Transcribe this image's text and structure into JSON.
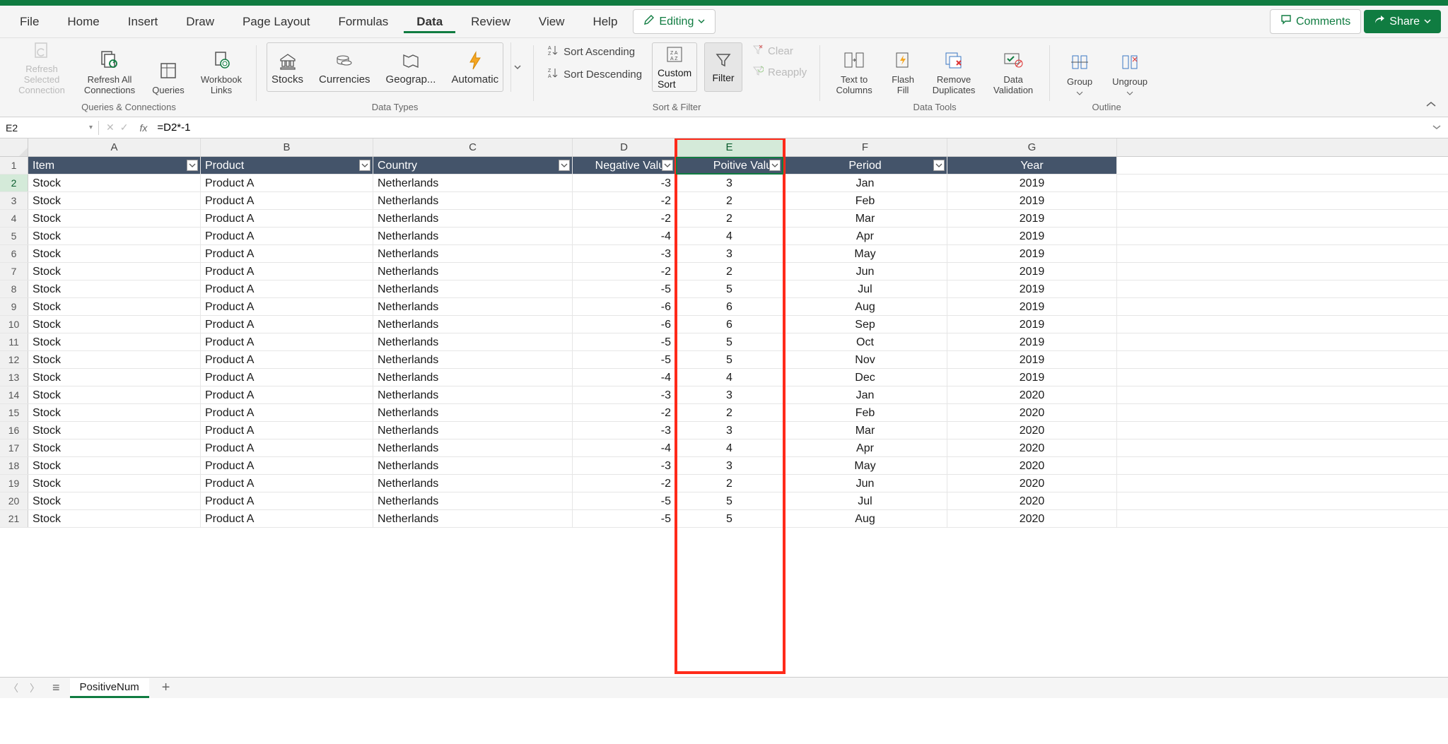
{
  "menu": {
    "file": "File",
    "home": "Home",
    "insert": "Insert",
    "draw": "Draw",
    "page_layout": "Page Layout",
    "formulas": "Formulas",
    "data": "Data",
    "review": "Review",
    "view": "View",
    "help": "Help"
  },
  "editing_label": "Editing",
  "comments_label": "Comments",
  "share_label": "Share",
  "ribbon": {
    "queries_conn": {
      "refresh_sel": "Refresh Selected Connection",
      "refresh_all": "Refresh All Connections",
      "queries": "Queries",
      "workbook_links": "Workbook Links",
      "group": "Queries & Connections"
    },
    "data_types": {
      "stocks": "Stocks",
      "currencies": "Currencies",
      "geography": "Geograp...",
      "automatic": "Automatic",
      "group": "Data Types"
    },
    "sort_filter": {
      "asc": "Sort Ascending",
      "desc": "Sort Descending",
      "custom": "Custom Sort",
      "filter": "Filter",
      "clear": "Clear",
      "reapply": "Reapply",
      "group": "Sort & Filter"
    },
    "data_tools": {
      "t2c": "Text to Columns",
      "flash": "Flash Fill",
      "dup": "Remove Duplicates",
      "valid": "Data Validation",
      "group": "Data Tools"
    },
    "outline": {
      "group": "Group",
      "ungroup": "Ungroup",
      "label": "Outline"
    }
  },
  "name_box": "E2",
  "formula": "=D2*-1",
  "columns": [
    "A",
    "B",
    "C",
    "D",
    "E",
    "F",
    "G"
  ],
  "headers": [
    "Item",
    "Product",
    "Country",
    "Negative Value",
    "Poitive Value",
    "Period",
    "Year"
  ],
  "rows": [
    {
      "n": 2,
      "item": "Stock",
      "product": "Product A",
      "country": "Netherlands",
      "neg": "-3",
      "pos": "3",
      "period": "Jan",
      "year": "2019"
    },
    {
      "n": 3,
      "item": "Stock",
      "product": "Product A",
      "country": "Netherlands",
      "neg": "-2",
      "pos": "2",
      "period": "Feb",
      "year": "2019"
    },
    {
      "n": 4,
      "item": "Stock",
      "product": "Product A",
      "country": "Netherlands",
      "neg": "-2",
      "pos": "2",
      "period": "Mar",
      "year": "2019"
    },
    {
      "n": 5,
      "item": "Stock",
      "product": "Product A",
      "country": "Netherlands",
      "neg": "-4",
      "pos": "4",
      "period": "Apr",
      "year": "2019"
    },
    {
      "n": 6,
      "item": "Stock",
      "product": "Product A",
      "country": "Netherlands",
      "neg": "-3",
      "pos": "3",
      "period": "May",
      "year": "2019"
    },
    {
      "n": 7,
      "item": "Stock",
      "product": "Product A",
      "country": "Netherlands",
      "neg": "-2",
      "pos": "2",
      "period": "Jun",
      "year": "2019"
    },
    {
      "n": 8,
      "item": "Stock",
      "product": "Product A",
      "country": "Netherlands",
      "neg": "-5",
      "pos": "5",
      "period": "Jul",
      "year": "2019"
    },
    {
      "n": 9,
      "item": "Stock",
      "product": "Product A",
      "country": "Netherlands",
      "neg": "-6",
      "pos": "6",
      "period": "Aug",
      "year": "2019"
    },
    {
      "n": 10,
      "item": "Stock",
      "product": "Product A",
      "country": "Netherlands",
      "neg": "-6",
      "pos": "6",
      "period": "Sep",
      "year": "2019"
    },
    {
      "n": 11,
      "item": "Stock",
      "product": "Product A",
      "country": "Netherlands",
      "neg": "-5",
      "pos": "5",
      "period": "Oct",
      "year": "2019"
    },
    {
      "n": 12,
      "item": "Stock",
      "product": "Product A",
      "country": "Netherlands",
      "neg": "-5",
      "pos": "5",
      "period": "Nov",
      "year": "2019"
    },
    {
      "n": 13,
      "item": "Stock",
      "product": "Product A",
      "country": "Netherlands",
      "neg": "-4",
      "pos": "4",
      "period": "Dec",
      "year": "2019"
    },
    {
      "n": 14,
      "item": "Stock",
      "product": "Product A",
      "country": "Netherlands",
      "neg": "-3",
      "pos": "3",
      "period": "Jan",
      "year": "2020"
    },
    {
      "n": 15,
      "item": "Stock",
      "product": "Product A",
      "country": "Netherlands",
      "neg": "-2",
      "pos": "2",
      "period": "Feb",
      "year": "2020"
    },
    {
      "n": 16,
      "item": "Stock",
      "product": "Product A",
      "country": "Netherlands",
      "neg": "-3",
      "pos": "3",
      "period": "Mar",
      "year": "2020"
    },
    {
      "n": 17,
      "item": "Stock",
      "product": "Product A",
      "country": "Netherlands",
      "neg": "-4",
      "pos": "4",
      "period": "Apr",
      "year": "2020"
    },
    {
      "n": 18,
      "item": "Stock",
      "product": "Product A",
      "country": "Netherlands",
      "neg": "-3",
      "pos": "3",
      "period": "May",
      "year": "2020"
    },
    {
      "n": 19,
      "item": "Stock",
      "product": "Product A",
      "country": "Netherlands",
      "neg": "-2",
      "pos": "2",
      "period": "Jun",
      "year": "2020"
    },
    {
      "n": 20,
      "item": "Stock",
      "product": "Product A",
      "country": "Netherlands",
      "neg": "-5",
      "pos": "5",
      "period": "Jul",
      "year": "2020"
    },
    {
      "n": 21,
      "item": "Stock",
      "product": "Product A",
      "country": "Netherlands",
      "neg": "-5",
      "pos": "5",
      "period": "Aug",
      "year": "2020"
    }
  ],
  "sheet_name": "PositiveNum"
}
